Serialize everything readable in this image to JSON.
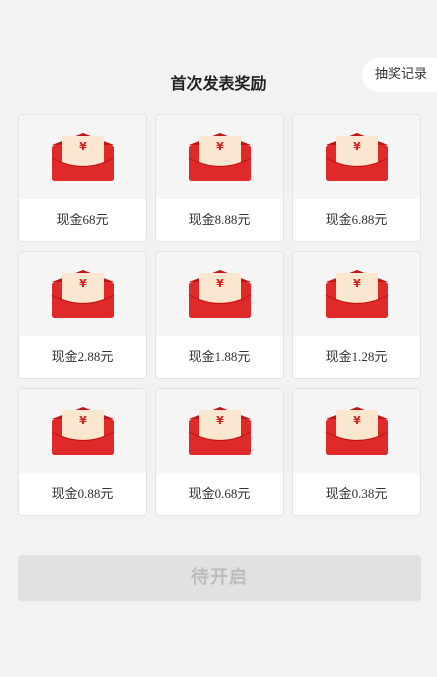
{
  "page": {
    "title": "首次发表奖励",
    "records_label": "抽奖记录"
  },
  "rewards": [
    {
      "label": "现金68元"
    },
    {
      "label": "现金8.88元"
    },
    {
      "label": "现金6.88元"
    },
    {
      "label": "现金2.88元"
    },
    {
      "label": "现金1.88元"
    },
    {
      "label": "现金1.28元"
    },
    {
      "label": "现金0.88元"
    },
    {
      "label": "现金0.68元"
    },
    {
      "label": "现金0.38元"
    }
  ],
  "envelope": {
    "symbol": "¥",
    "icon": "red-envelope-icon",
    "colors": {
      "body": "#e02a2a",
      "flap": "#c41515",
      "letter": "#fbe6cf",
      "symbol": "#d42020"
    }
  },
  "action": {
    "label": "待开启",
    "state": "disabled"
  }
}
